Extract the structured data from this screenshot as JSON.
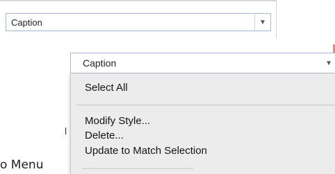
{
  "top_select": {
    "value": "Caption",
    "arrow": "▼"
  },
  "dropdown": {
    "value": "Caption",
    "arrow": "▼",
    "items": [
      {
        "label": "Select All"
      },
      {
        "label": "Modify Style..."
      },
      {
        "label": "Delete..."
      },
      {
        "label": "Update to Match Selection"
      }
    ]
  },
  "background": {
    "menu_label_partial": "o Menu",
    "left_fragment": "l"
  }
}
